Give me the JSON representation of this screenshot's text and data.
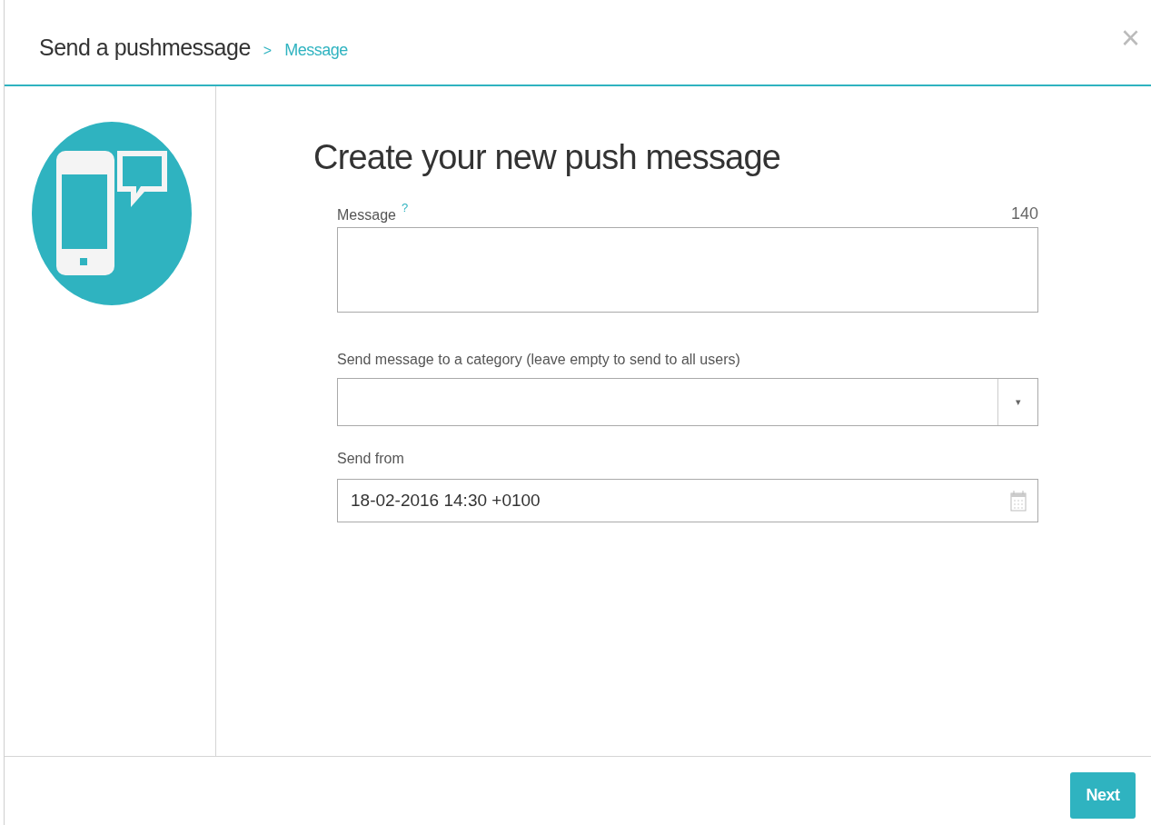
{
  "header": {
    "title": "Send a pushmessage",
    "separator": ">",
    "step": "Message",
    "close": "×"
  },
  "heading": "Create your new push message",
  "message": {
    "label": "Message",
    "help": "?",
    "counter": "140"
  },
  "category": {
    "label": "Send message to a category (leave empty to send to all users)",
    "caret": "▾"
  },
  "send_from": {
    "label": "Send from",
    "value": "18-02-2016 14:30 +0100"
  },
  "footer": {
    "button": "Next"
  }
}
